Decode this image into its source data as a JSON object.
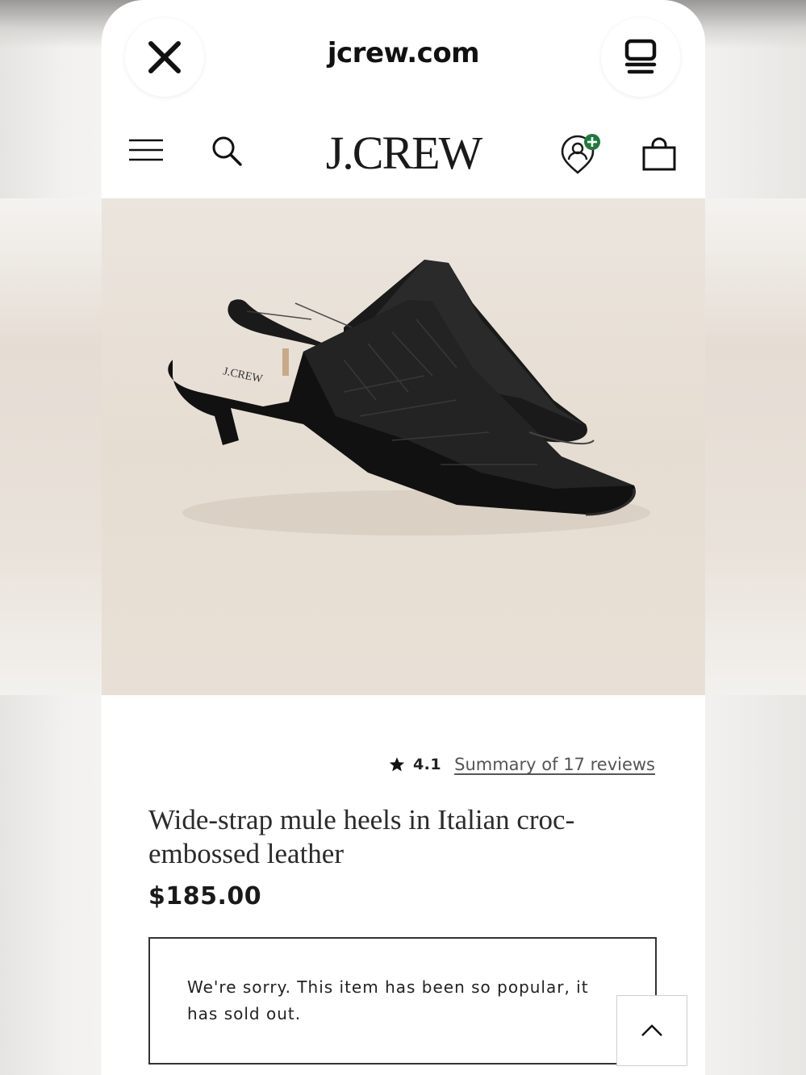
{
  "browser": {
    "url": "jcrew.com",
    "close_icon": "close-icon",
    "tabs_icon": "tabs-icon"
  },
  "site_header": {
    "logo": "J.CREW",
    "menu_icon": "hamburger-menu-icon",
    "search_icon": "search-icon",
    "account_icon": "account-add-icon",
    "bag_icon": "shopping-bag-icon"
  },
  "product": {
    "image_alt": "black croc-embossed mule heels",
    "rating_icon": "star-icon",
    "rating": "4.1",
    "reviews_link": "Summary of 17 reviews",
    "title": "Wide-strap mule heels in Italian croc-embossed leather",
    "price": "$185.00",
    "sold_out_message": "We're sorry. This item has been so popular, it has sold out."
  },
  "scroll_top_icon": "chevron-up-icon",
  "colors": {
    "text": "#111111",
    "hero_bg": "#e8e0d6",
    "account_badge": "#1e7a3c"
  }
}
